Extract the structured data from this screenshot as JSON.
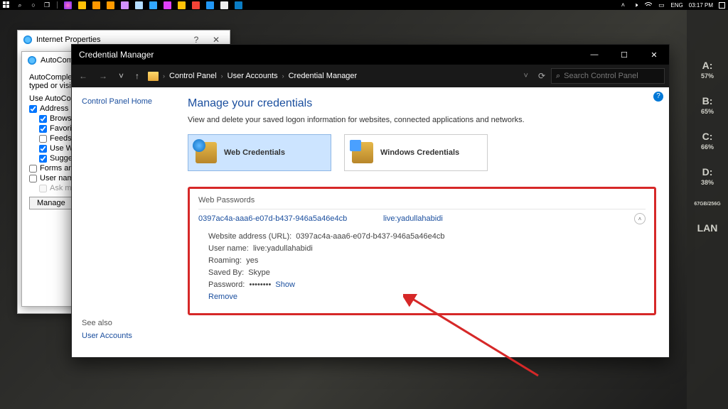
{
  "taskbar": {
    "lang": "ENG",
    "time": "03:17 PM"
  },
  "ip_dialog": {
    "title": "Internet Properties"
  },
  "autocomplete_dialog": {
    "title_prefix": "AutoComple",
    "intro1": "AutoComplete li",
    "intro2": "typed or visited",
    "use_label": "Use AutoComp",
    "addr": "Address ba",
    "browsing": "Browsin",
    "favorites": "Favorit",
    "feeds": "Feeds",
    "usewi": "Use Wi",
    "sugges": "Sugges",
    "forms": "Forms and",
    "usernames": "User names",
    "askme": "Ask me",
    "manage": "Manage"
  },
  "cm": {
    "title": "Credential Manager",
    "breadcrumb": [
      "Control Panel",
      "User Accounts",
      "Credential Manager"
    ],
    "search_placeholder": "Search Control Panel",
    "left": {
      "home": "Control Panel Home",
      "see_also": "See also",
      "user_accounts": "User Accounts"
    },
    "heading": "Manage your credentials",
    "sub": "View and delete your saved logon information for websites, connected applications and networks.",
    "card_web": "Web Credentials",
    "card_win": "Windows Credentials",
    "wp_header": "Web Passwords",
    "entry": {
      "url_short": "0397ac4a-aaa6-e07d-b437-946a5a46e4cb",
      "live": "live:yadullahabidi",
      "url_label": "Website address (URL):",
      "url_value": "0397ac4a-aaa6-e07d-b437-946a5a46e4cb",
      "user_label": "User name:",
      "user_value": "live:yadullahabidi",
      "roaming_label": "Roaming:",
      "roaming_value": "yes",
      "savedby_label": "Saved By:",
      "savedby_value": "Skype",
      "password_label": "Password:",
      "password_value": "••••••••",
      "show": "Show",
      "remove": "Remove"
    }
  },
  "side": {
    "a": "A:",
    "a_v": "57%",
    "b": "B:",
    "b_v": "65%",
    "c": "C:",
    "c_v": "66%",
    "d": "D:",
    "d_v": "38%",
    "e": "67GB/256G",
    "lan": "LAN"
  }
}
